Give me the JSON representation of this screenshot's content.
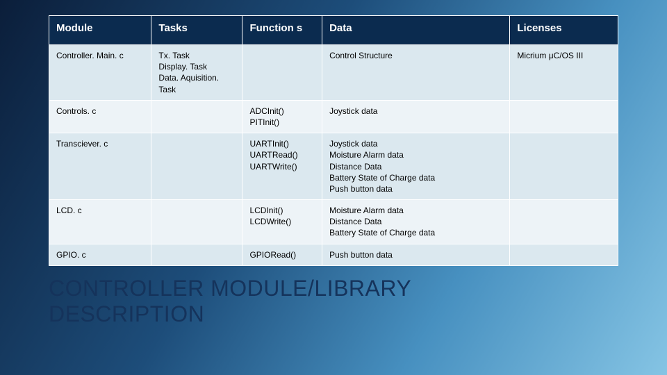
{
  "title_line1": "CONTROLLER MODULE/LIBRARY",
  "title_line2": "DESCRIPTION",
  "headers": {
    "module": "Module",
    "tasks": "Tasks",
    "functions": "Function s",
    "data": "Data",
    "licenses": "Licenses"
  },
  "rows": [
    {
      "module": "Controller. Main. c",
      "tasks": "Tx. Task\nDisplay. Task\nData. Aquisition. Task",
      "functions": "",
      "data": "Control Structure",
      "licenses": "Micrium μC/OS III"
    },
    {
      "module": "Controls. c",
      "tasks": "",
      "functions": "ADCInit()\nPITInit()",
      "data": "Joystick data",
      "licenses": ""
    },
    {
      "module": "Transciever. c",
      "tasks": "",
      "functions": "UARTInit()\nUARTRead()\nUARTWrite()",
      "data": "Joystick data\nMoisture Alarm data\nDistance Data\nBattery State of Charge data\nPush button data",
      "licenses": ""
    },
    {
      "module": "LCD. c",
      "tasks": "",
      "functions": "LCDInit()\nLCDWrite()",
      "data": "Moisture Alarm data\nDistance Data\nBattery State of Charge data",
      "licenses": ""
    },
    {
      "module": "GPIO. c",
      "tasks": "",
      "functions": "GPIORead()",
      "data": "Push button data",
      "licenses": ""
    }
  ]
}
